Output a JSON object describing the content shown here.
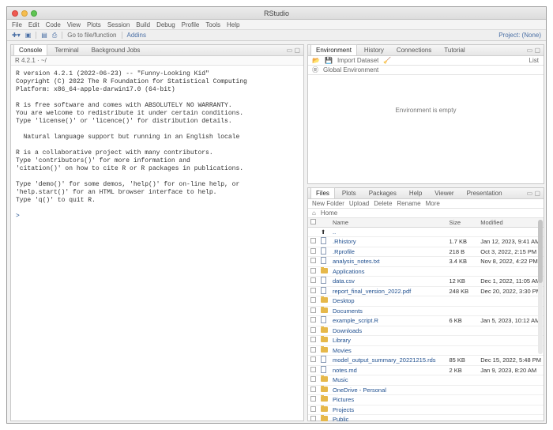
{
  "window": {
    "title": "RStudio"
  },
  "menu": [
    "File",
    "Edit",
    "Code",
    "View",
    "Plots",
    "Session",
    "Build",
    "Debug",
    "Profile",
    "Tools",
    "Help"
  ],
  "toolbar": {
    "go_to": "Go to file/function",
    "addins": "Addins",
    "project": "Project: (None)"
  },
  "console": {
    "tabs": [
      "Console",
      "Terminal",
      "Background Jobs"
    ],
    "path": "R 4.2.1 · ~/",
    "paragraphs": [
      "R version 4.2.1 (2022-06-23) -- \"Funny-Looking Kid\"\nCopyright (C) 2022 The R Foundation for Statistical Computing\nPlatform: x86_64-apple-darwin17.0 (64-bit)",
      "R is free software and comes with ABSOLUTELY NO WARRANTY.\nYou are welcome to redistribute it under certain conditions.\nType 'license()' or 'licence()' for distribution details.",
      "  Natural language support but running in an English locale",
      "R is a collaborative project with many contributors.\nType 'contributors()' for more information and\n'citation()' on how to cite R or R packages in publications.",
      "Type 'demo()' for some demos, 'help()' for on-line help, or\n'help.start()' for an HTML browser interface to help.\nType 'q()' to quit R."
    ],
    "prompt": ">"
  },
  "environment": {
    "tabs": [
      "Environment",
      "History",
      "Connections",
      "Tutorial"
    ],
    "toolbar": [
      "Import Dataset",
      "Global Environment"
    ],
    "memory": "List",
    "empty_message": "Environment is empty"
  },
  "files": {
    "tabs": [
      "Files",
      "Plots",
      "Packages",
      "Help",
      "Viewer",
      "Presentation"
    ],
    "toolbar": [
      "New Folder",
      "Upload",
      "Delete",
      "Rename",
      "More"
    ],
    "breadcrumb": "Home",
    "headers": [
      "Name",
      "Size",
      "Modified"
    ],
    "updir": "..",
    "rows": [
      {
        "type": "file",
        "name": ".Rhistory",
        "size": "1.7 KB",
        "modified": "Jan 12, 2023, 9:41 AM"
      },
      {
        "type": "file",
        "name": ".Rprofile",
        "size": "218 B",
        "modified": "Oct 3, 2022, 2:15 PM"
      },
      {
        "type": "file",
        "name": "analysis_notes.txt",
        "size": "3.4 KB",
        "modified": "Nov 8, 2022, 4:22 PM"
      },
      {
        "type": "folder",
        "name": "Applications",
        "size": "",
        "modified": ""
      },
      {
        "type": "file",
        "name": "data.csv",
        "size": "12 KB",
        "modified": "Dec 1, 2022, 11:05 AM"
      },
      {
        "type": "file",
        "name": "report_final_version_2022.pdf",
        "size": "248 KB",
        "modified": "Dec 20, 2022, 3:30 PM"
      },
      {
        "type": "folder",
        "name": "Desktop",
        "size": "",
        "modified": ""
      },
      {
        "type": "folder",
        "name": "Documents",
        "size": "",
        "modified": ""
      },
      {
        "type": "file",
        "name": "example_script.R",
        "size": "6 KB",
        "modified": "Jan 5, 2023, 10:12 AM"
      },
      {
        "type": "folder",
        "name": "Downloads",
        "size": "",
        "modified": ""
      },
      {
        "type": "folder",
        "name": "Library",
        "size": "",
        "modified": ""
      },
      {
        "type": "folder",
        "name": "Movies",
        "size": "",
        "modified": ""
      },
      {
        "type": "file",
        "name": "model_output_summary_20221215.rds",
        "size": "85 KB",
        "modified": "Dec 15, 2022, 5:48 PM"
      },
      {
        "type": "file",
        "name": "notes.md",
        "size": "2 KB",
        "modified": "Jan 9, 2023, 8:20 AM"
      },
      {
        "type": "folder",
        "name": "Music",
        "size": "",
        "modified": ""
      },
      {
        "type": "folder",
        "name": "OneDrive - Personal",
        "size": "",
        "modified": ""
      },
      {
        "type": "folder",
        "name": "Pictures",
        "size": "",
        "modified": ""
      },
      {
        "type": "folder",
        "name": "Projects",
        "size": "",
        "modified": ""
      },
      {
        "type": "folder",
        "name": "Public",
        "size": "",
        "modified": ""
      }
    ]
  }
}
